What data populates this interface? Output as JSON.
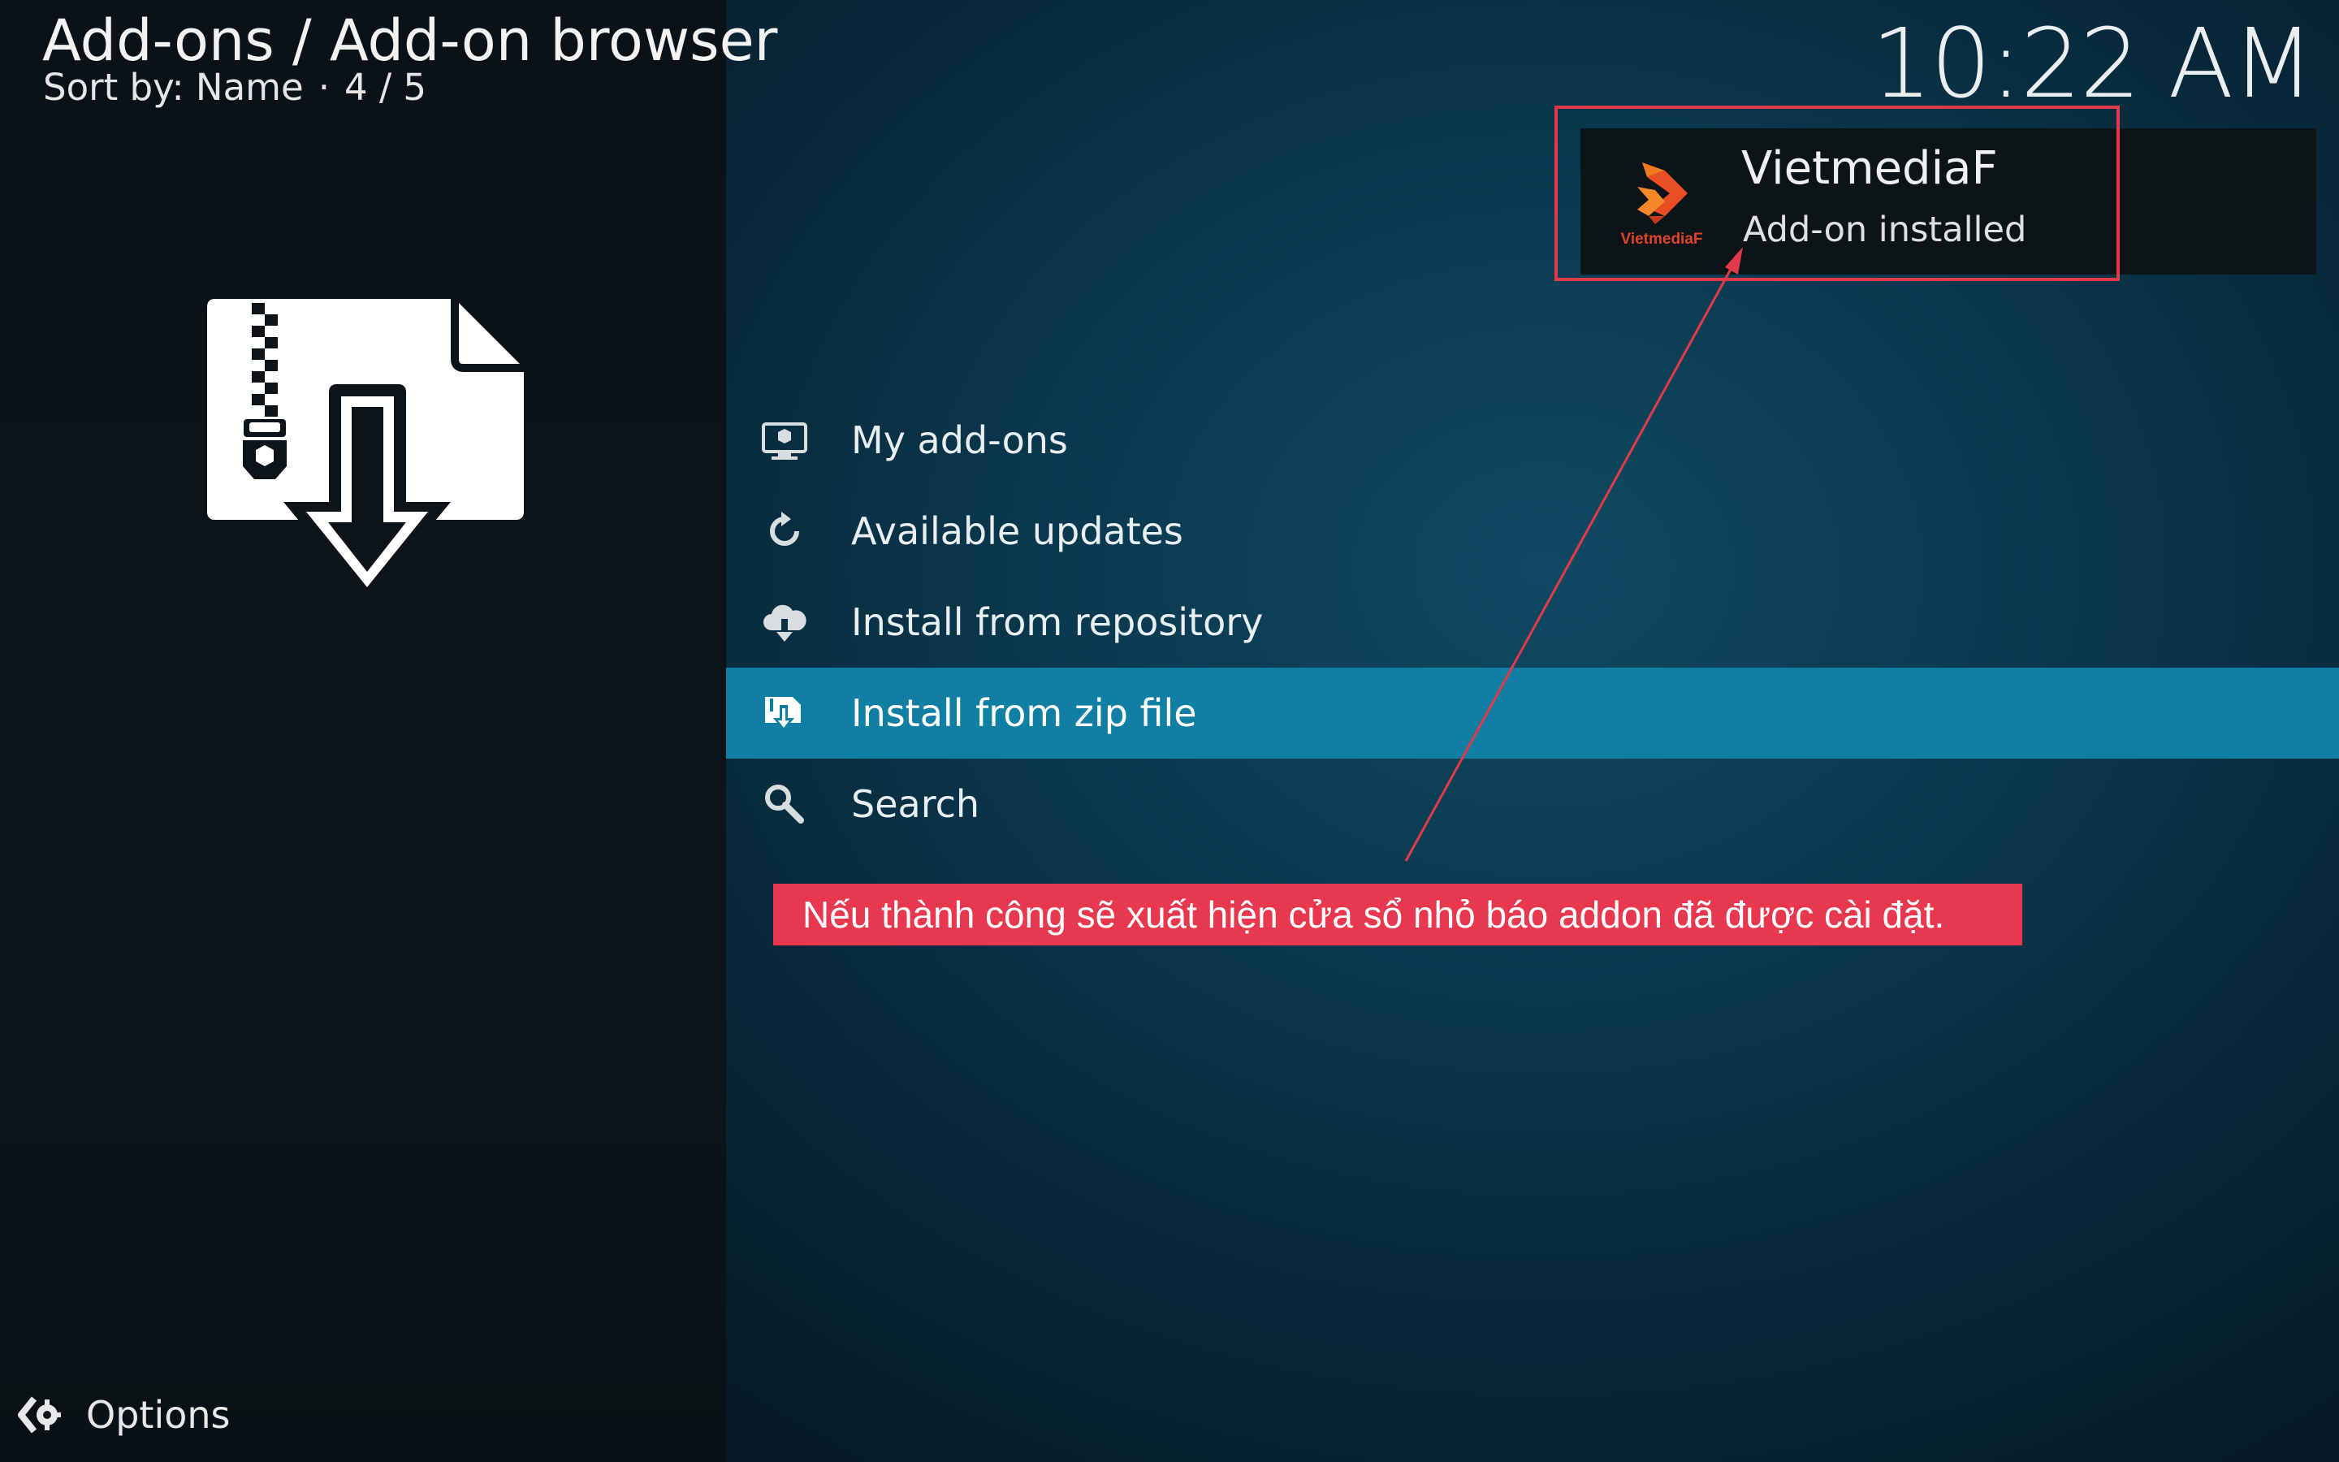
{
  "header": {
    "breadcrumb": "Add-ons / Add-on browser",
    "sort_label": "Sort by: Name",
    "separator": "·",
    "position": "4 / 5"
  },
  "clock": "10:22 AM",
  "menu": {
    "items": [
      {
        "label": "My add-ons",
        "icon": "monitor-box-icon"
      },
      {
        "label": "Available updates",
        "icon": "refresh-icon"
      },
      {
        "label": "Install from repository",
        "icon": "cloud-download-icon"
      },
      {
        "label": "Install from zip file",
        "icon": "zip-install-icon",
        "selected": true
      },
      {
        "label": "Search",
        "icon": "search-icon"
      }
    ]
  },
  "footer": {
    "options_label": "Options"
  },
  "notification": {
    "title": "VietmediaF",
    "subtitle": "Add-on installed",
    "logo_text": "VietmediaF"
  },
  "annotation": {
    "caption": "Nếu thành công sẽ xuất hiện cửa sổ nhỏ báo addon đã được cài đặt.",
    "color": "#e8384f"
  },
  "colors": {
    "selected": "#117fa3",
    "highlight": "#e23a4a"
  }
}
